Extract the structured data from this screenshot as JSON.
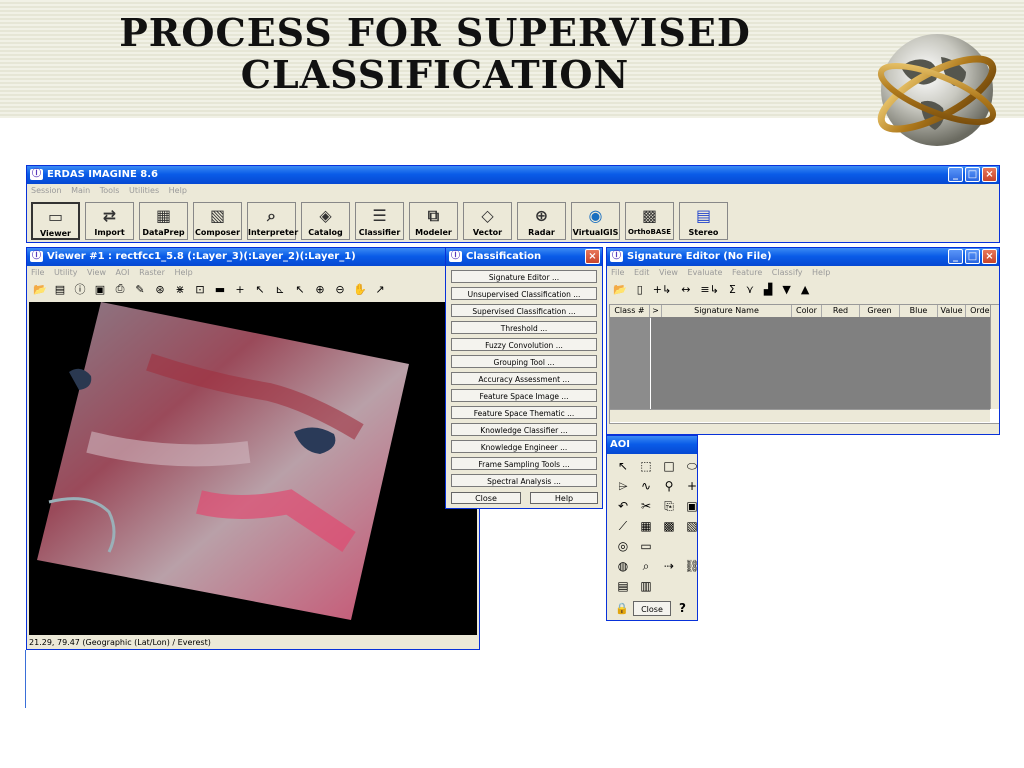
{
  "slide": {
    "title_line1": "PROCESS FOR SUPERVISED",
    "title_line2": "CLASSIFICATION"
  },
  "erdas": {
    "title": "ERDAS IMAGINE 8.6",
    "menu": [
      "Session",
      "Main",
      "Tools",
      "Utilities",
      "Help"
    ],
    "toolbar": [
      {
        "label": "Viewer",
        "icon": "viewer-icon",
        "active": true
      },
      {
        "label": "Import",
        "icon": "import-icon"
      },
      {
        "label": "DataPrep",
        "icon": "dataprep-icon"
      },
      {
        "label": "Composer",
        "icon": "composer-icon"
      },
      {
        "label": "Interpreter",
        "icon": "interpreter-icon"
      },
      {
        "label": "Catalog",
        "icon": "catalog-icon"
      },
      {
        "label": "Classifier",
        "icon": "classifier-icon"
      },
      {
        "label": "Modeler",
        "icon": "modeler-icon"
      },
      {
        "label": "Vector",
        "icon": "vector-icon"
      },
      {
        "label": "Radar",
        "icon": "radar-icon"
      },
      {
        "label": "VirtualGIS",
        "icon": "virtualgis-icon"
      },
      {
        "label": "OrthoBASE",
        "icon": "orthobase-icon"
      },
      {
        "label": "Stereo",
        "icon": "stereo-icon"
      }
    ]
  },
  "viewer": {
    "title": "Viewer #1 : rectfcc1_5.8 (:Layer_3)(:Layer_2)(:Layer_1)",
    "menu": [
      "File",
      "Utility",
      "View",
      "AOI",
      "Raster",
      "Help"
    ],
    "status": "21.29, 79.47  (Geographic (Lat/Lon) / Everest)"
  },
  "classification": {
    "title": "Classification",
    "items": [
      "Signature Editor ...",
      "Unsupervised Classification ...",
      "Supervised Classification ...",
      "Threshold ...",
      "Fuzzy Convolution ...",
      "Grouping Tool ...",
      "Accuracy Assessment ...",
      "Feature Space Image ...",
      "Feature Space Thematic ...",
      "Knowledge Classifier ...",
      "Knowledge Engineer ...",
      "Frame Sampling Tools ...",
      "Spectral Analysis ..."
    ],
    "close_label": "Close",
    "help_label": "Help"
  },
  "signature_editor": {
    "title": "Signature Editor (No File)",
    "menu": [
      "File",
      "Edit",
      "View",
      "Evaluate",
      "Feature",
      "Classify",
      "Help"
    ],
    "columns": [
      "Class #",
      ">",
      "Signature Name",
      "Color",
      "Red",
      "Green",
      "Blue",
      "Value",
      "Order"
    ]
  },
  "aoi": {
    "title": "AOI",
    "close_label": "Close",
    "help_label": "?"
  },
  "colors": {
    "title_blue": "#0a5ce8",
    "window_bg": "#ece9d8"
  }
}
